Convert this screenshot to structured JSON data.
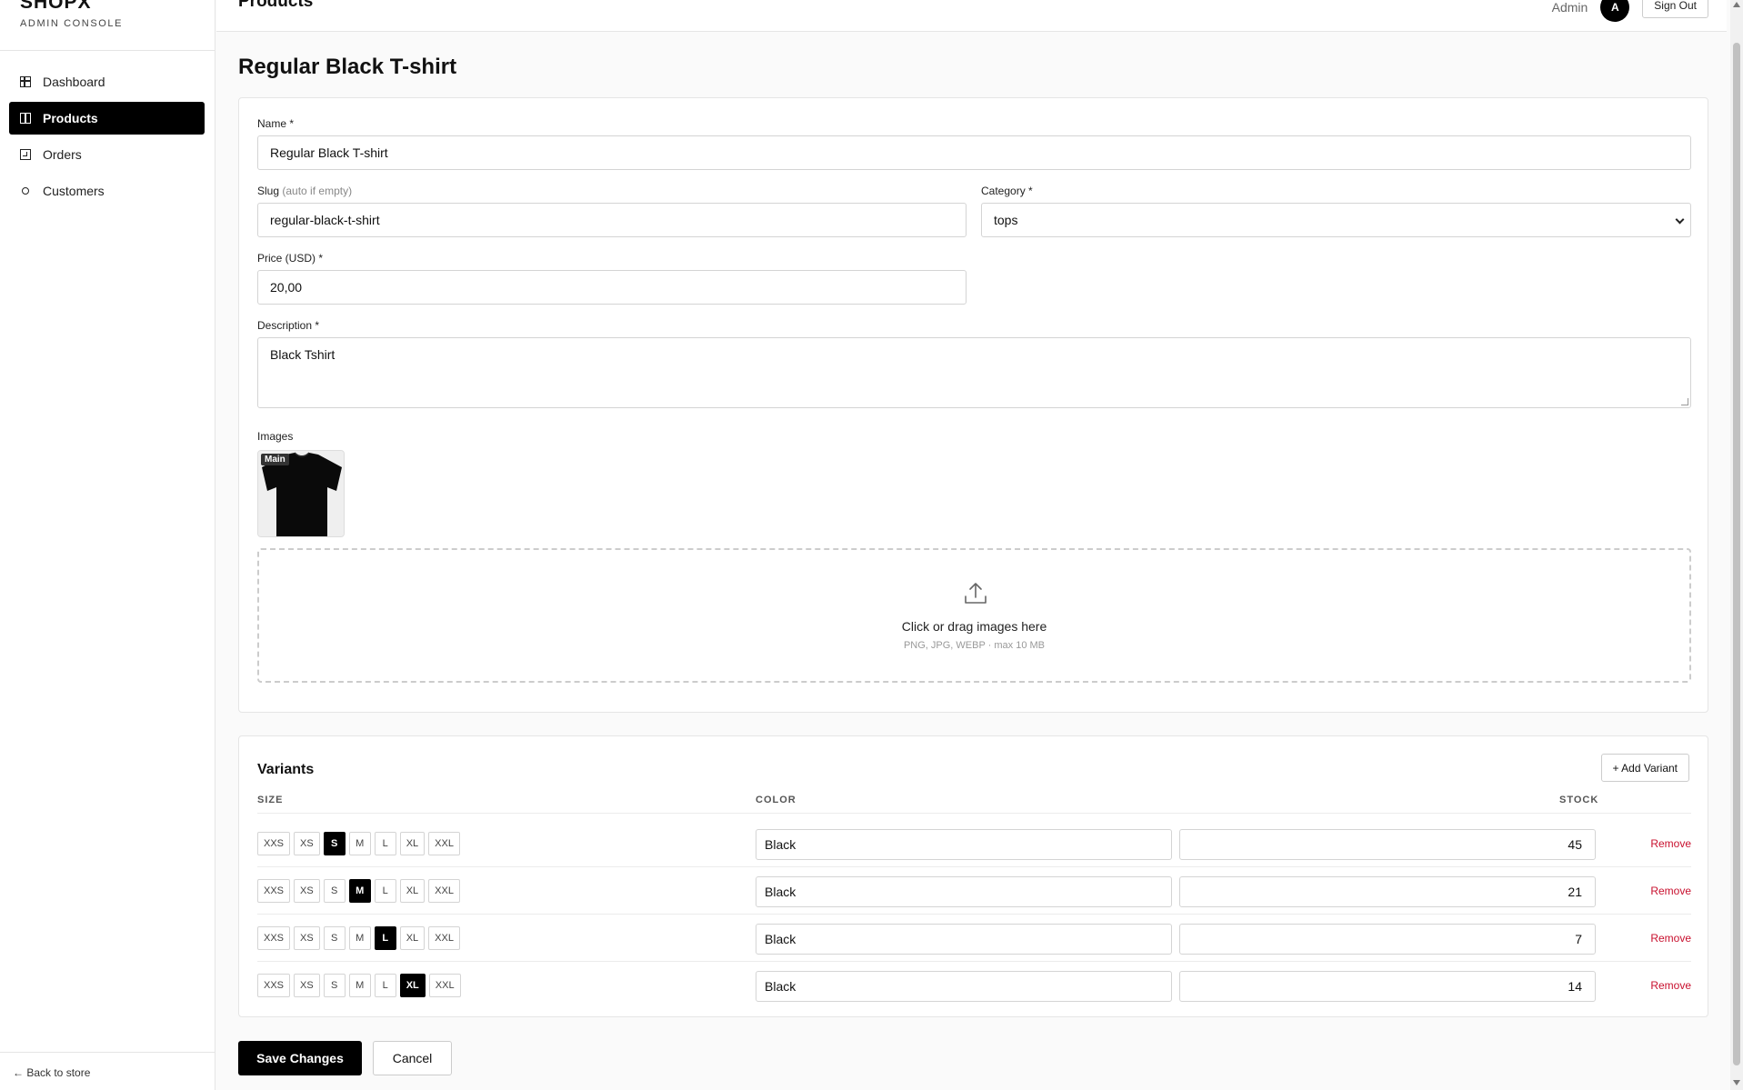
{
  "brand": {
    "name": "SHOPX",
    "subtitle": "ADMIN CONSOLE"
  },
  "sidebar": {
    "items": [
      {
        "label": "Dashboard",
        "icon": "grid-icon",
        "active": false
      },
      {
        "label": "Products",
        "icon": "columns-icon",
        "active": true
      },
      {
        "label": "Orders",
        "icon": "document-icon",
        "active": false
      },
      {
        "label": "Customers",
        "icon": "circle-icon",
        "active": false
      }
    ],
    "back_link": "← Back to store"
  },
  "topbar": {
    "title": "Products",
    "user_label": "Admin",
    "avatar_initial": "A",
    "signout_label": "Sign Out"
  },
  "page": {
    "title": "Regular Black T-shirt"
  },
  "form": {
    "name": {
      "label": "Name *",
      "value": "Regular Black T-shirt"
    },
    "slug": {
      "label": "Slug",
      "hint": "(auto if empty)",
      "value": "regular-black-t-shirt"
    },
    "category": {
      "label": "Category *",
      "value": "tops"
    },
    "price": {
      "label": "Price (USD) *",
      "value": "20,00"
    },
    "description": {
      "label": "Description *",
      "value": "Black Tshirt"
    },
    "images": {
      "label": "Images",
      "main_badge": "Main",
      "dropzone_text": "Click or drag images here",
      "dropzone_sub": "PNG, JPG, WEBP · max 10 MB"
    }
  },
  "variants": {
    "title": "Variants",
    "add_label": "+ Add Variant",
    "headers": {
      "size": "SIZE",
      "color": "COLOR",
      "stock": "STOCK"
    },
    "size_options": [
      "XXS",
      "XS",
      "S",
      "M",
      "L",
      "XL",
      "XXL"
    ],
    "remove_label": "Remove",
    "rows": [
      {
        "selected_size": "S",
        "color": "Black",
        "stock": "45"
      },
      {
        "selected_size": "M",
        "color": "Black",
        "stock": "21"
      },
      {
        "selected_size": "L",
        "color": "Black",
        "stock": "7"
      },
      {
        "selected_size": "XL",
        "color": "Black",
        "stock": "14"
      }
    ]
  },
  "actions": {
    "save_label": "Save Changes",
    "cancel_label": "Cancel"
  },
  "colors": {
    "accent": "#000000",
    "danger": "#c8102e",
    "border": "#d4d4d4"
  }
}
